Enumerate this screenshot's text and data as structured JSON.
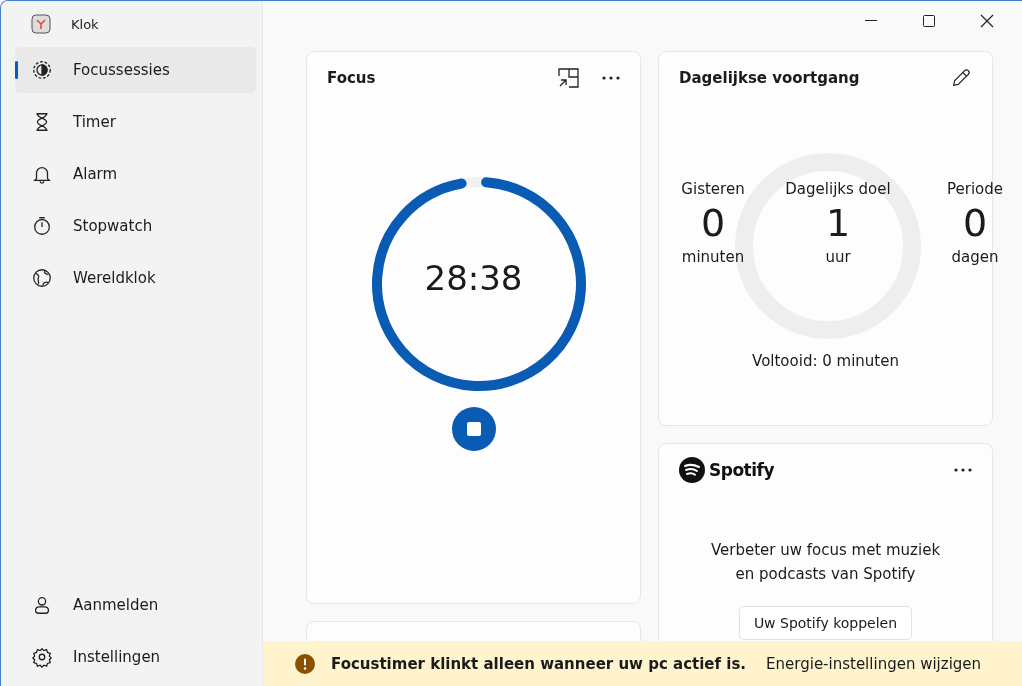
{
  "app": {
    "title": "Klok"
  },
  "nav": [
    {
      "label": "Focussessies",
      "kind": "focus",
      "selected": true
    },
    {
      "label": "Timer",
      "kind": "timer",
      "selected": false
    },
    {
      "label": "Alarm",
      "kind": "alarm",
      "selected": false
    },
    {
      "label": "Stopwatch",
      "kind": "stopwatch",
      "selected": false
    },
    {
      "label": "Wereldklok",
      "kind": "world",
      "selected": false
    }
  ],
  "nav_footer": [
    {
      "label": "Aanmelden",
      "kind": "person",
      "selected": false
    },
    {
      "label": "Instellingen",
      "kind": "settings",
      "selected": false
    }
  ],
  "focus_card": {
    "title": "Focus",
    "time": "28:38",
    "level": 0.96
  },
  "progress_card": {
    "title": "Dagelijkse voortgang",
    "stats": [
      {
        "label": "Gisteren",
        "value": "0",
        "unit": "minuten"
      },
      {
        "label": "Dagelijks doel",
        "value": "1",
        "unit": "uur"
      },
      {
        "label": "Periode",
        "value": "0",
        "unit": "dagen"
      }
    ],
    "completed": "Voltooid: 0 minuten"
  },
  "spotify_card": {
    "brand": "Spotify",
    "message": "Verbeter uw focus met muziek en podcasts van Spotify",
    "button": "Uw Spotify koppelen"
  },
  "banner": {
    "message": "Focustimer klinkt alleen wanneer uw pc actief is.",
    "link": "Energie-instellingen wijzigen"
  }
}
